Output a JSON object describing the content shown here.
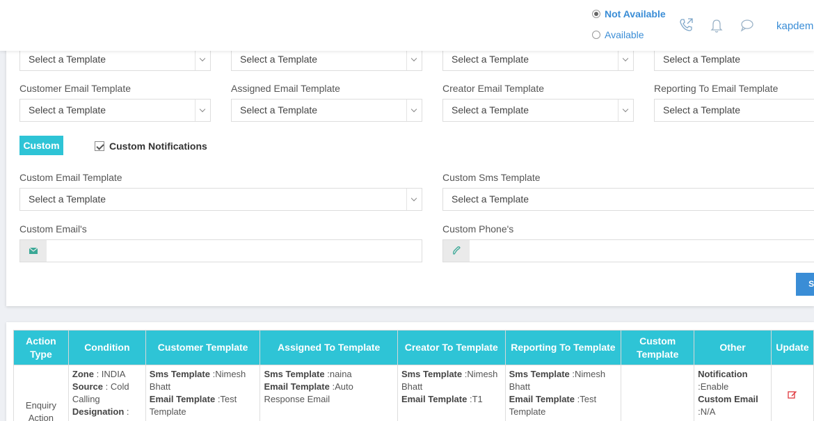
{
  "header": {
    "status_options": [
      {
        "label": "Not Available",
        "selected": true
      },
      {
        "label": "Available",
        "selected": false
      }
    ],
    "icons": [
      "phone-icon",
      "bell-icon",
      "chat-icon"
    ],
    "user": "kapdem"
  },
  "form": {
    "row1_selects": [
      "Select a Template",
      "Select a Template",
      "Select a Template",
      "Select a Template"
    ],
    "row2": [
      {
        "label": "Customer Email Template",
        "value": "Select a Template"
      },
      {
        "label": "Assigned Email Template",
        "value": "Select a Template"
      },
      {
        "label": "Creator Email Template",
        "value": "Select a Template"
      },
      {
        "label": "Reporting To Email Template",
        "value": "Select a Template"
      }
    ],
    "custom_badge": "Custom",
    "custom_notifications_label": "Custom Notifications",
    "custom_notifications_checked": true,
    "custom_email_template": {
      "label": "Custom Email Template",
      "value": "Select a Template"
    },
    "custom_sms_template": {
      "label": "Custom Sms Template",
      "value": "Select a Template"
    },
    "custom_emails": {
      "label": "Custom Email's",
      "value": ""
    },
    "custom_phones": {
      "label": "Custom Phone's",
      "value": ""
    },
    "save_label": "SA"
  },
  "table": {
    "headers": [
      "Action Type",
      "Condition",
      "Customer Template",
      "Assigned To Template",
      "Creator To Template",
      "Reporting To Template",
      "Custom Template",
      "Other",
      "Update"
    ],
    "row": {
      "action_type": "Enquiry Action",
      "condition": [
        {
          "k": "Zone",
          "v": " : INDIA"
        },
        {
          "k": "Source",
          "v": " : Cold Calling"
        },
        {
          "k": "Designation",
          "v": " :"
        }
      ],
      "customer": [
        {
          "k": "Sms Template",
          "v": " :Nimesh Bhatt"
        },
        {
          "k": "Email Template",
          "v": " :Test Template"
        }
      ],
      "assigned": [
        {
          "k": "Sms Template",
          "v": " :naina"
        },
        {
          "k": "Email Template",
          "v": " :Auto Response Email"
        }
      ],
      "creator": [
        {
          "k": "Sms Template",
          "v": " :Nimesh Bhatt"
        },
        {
          "k": "Email Template",
          "v": " :T1"
        }
      ],
      "reporting": [
        {
          "k": "Sms Template",
          "v": " :Nimesh Bhatt"
        },
        {
          "k": "Email Template",
          "v": " :Test Template"
        }
      ],
      "custom": "",
      "other": [
        {
          "k": "Notification",
          "v": " :Enable"
        },
        {
          "k": "Custom Email",
          "v": " :N/A"
        }
      ]
    }
  },
  "colors": {
    "accent": "#2ec4d6",
    "link": "#3a8dd6",
    "edit": "#e0383e"
  }
}
